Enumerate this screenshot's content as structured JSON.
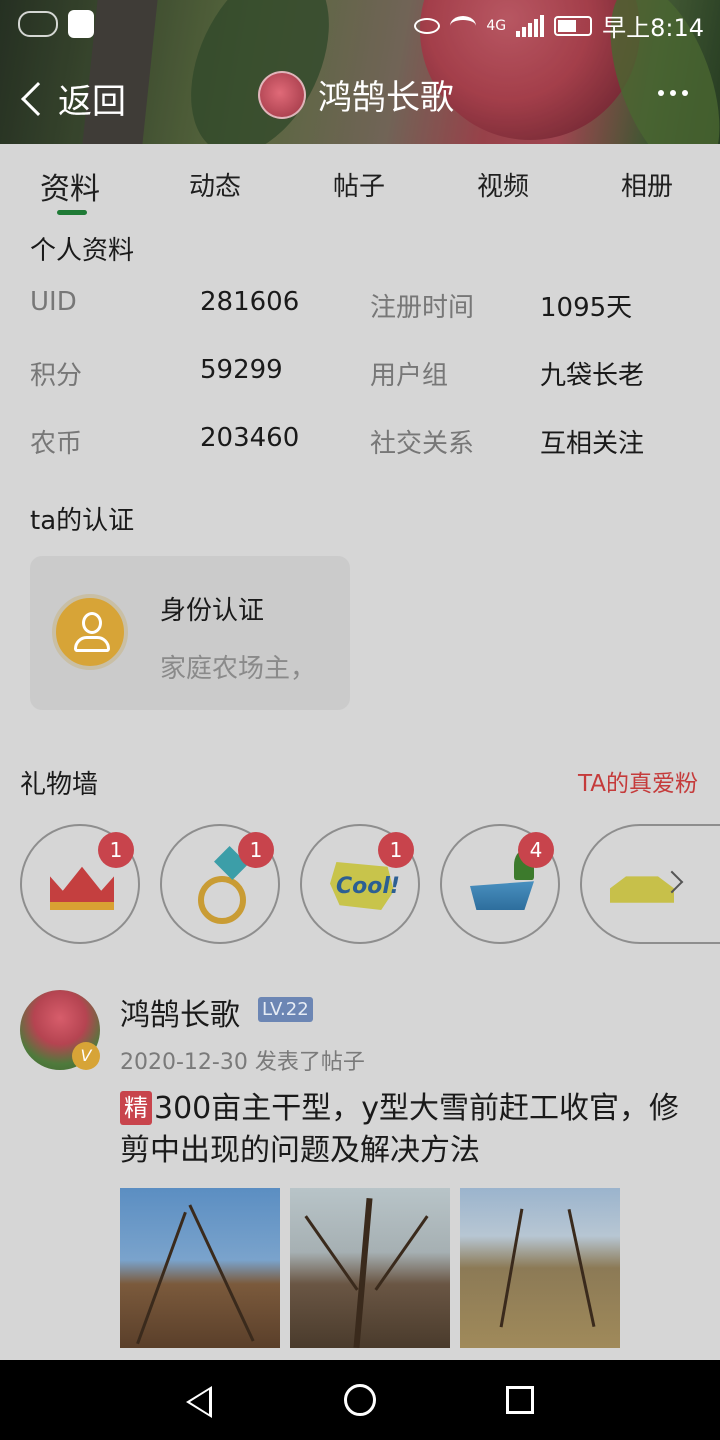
{
  "status_bar": {
    "time": "早上8:14",
    "network": "4G"
  },
  "nav": {
    "back_label": "返回",
    "title": "鸿鹄长歌"
  },
  "tabs": [
    {
      "label": "资料",
      "active": true
    },
    {
      "label": "动态"
    },
    {
      "label": "帖子"
    },
    {
      "label": "视频"
    },
    {
      "label": "相册"
    }
  ],
  "profile": {
    "section_title": "个人资料",
    "fields": [
      {
        "label": "UID",
        "value": "281606"
      },
      {
        "label": "注册时间",
        "value": "1095天"
      },
      {
        "label": "积分",
        "value": "59299"
      },
      {
        "label": "用户组",
        "value": "九袋长老"
      },
      {
        "label": "农币",
        "value": "203460"
      },
      {
        "label": "社交关系",
        "value": "互相关注"
      }
    ]
  },
  "certification": {
    "section_title": "ta的认证",
    "title": "身份认证",
    "subtitle": "家庭农场主，"
  },
  "gifts": {
    "section_title": "礼物墙",
    "fans_link": "TA的真爱粉",
    "items": [
      {
        "name": "crown",
        "count": "1"
      },
      {
        "name": "ring",
        "count": "1"
      },
      {
        "name": "cool",
        "count": "1",
        "text": "Cool!"
      },
      {
        "name": "yacht",
        "count": "4"
      },
      {
        "name": "car"
      }
    ]
  },
  "post": {
    "author": "鸿鹄长歌",
    "level": "LV.22",
    "verify": "V",
    "date": "2020-12-30",
    "action": "发表了帖子",
    "tag": "精",
    "title": "300亩主干型，y型大雪前赶工收官，修剪中出现的问题及解决方法"
  },
  "colors": {
    "accent_green": "#1f7a36",
    "fans_red": "#c53b3b",
    "badge_red": "#c8444c",
    "level_blue": "#6c86b4"
  }
}
